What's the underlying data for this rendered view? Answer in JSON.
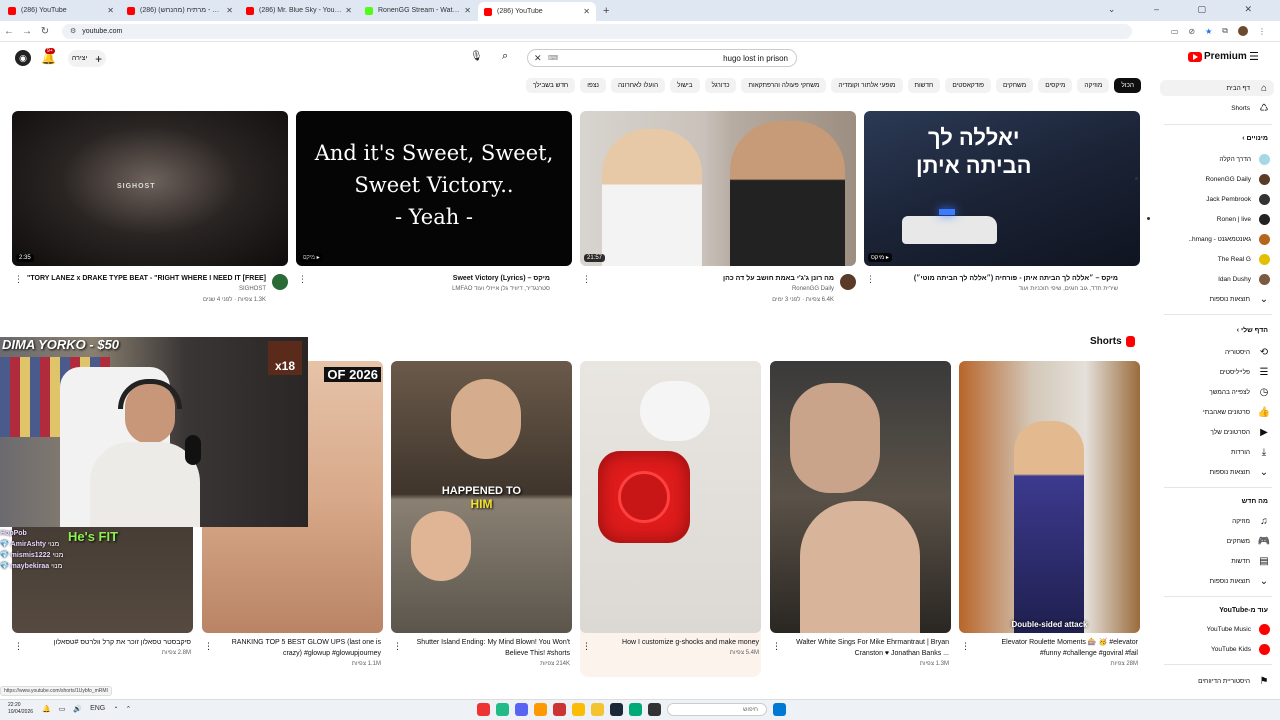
{
  "browser": {
    "tabs": [
      {
        "title": "(286) YouTube",
        "color": "#ff0000"
      },
      {
        "title": "עמוד - מרתיח (מהנחש) (286)",
        "color": "#ff0000"
      },
      {
        "title": "(286) Mr. Blue Sky - YouTube",
        "color": "#ff0000"
      },
      {
        "title": "RonenGG Stream - Watch Live",
        "color": "#53fc18"
      },
      {
        "title": "(286) YouTube",
        "color": "#ff0000"
      }
    ],
    "url": "youtube.com"
  },
  "masthead": {
    "notifications": "9+",
    "create_label": "יצירה",
    "search_value": "hugo lost in prison",
    "logo_label": "Premium"
  },
  "chips": [
    "הכול",
    "מוזיקה",
    "מיקסים",
    "משחקים",
    "פודקאסטים",
    "חדשות",
    "מופעי אלתור וקומדיה",
    "משחקי פעולה והרפתקאות",
    "כדורגל",
    "בישול",
    "הועלו לאחרונה",
    "נצפו",
    "חדש בשבילך"
  ],
  "videos": [
    {
      "title": "מיקס – ״אללה לך הביתה איתן - פורחיה (״אללה לך הביתה מוטי״)",
      "meta1": "שירית חדד, גוב חוגים, שיפי תוכניות ועוד",
      "meta2": "",
      "badge": "מיקס",
      "avatar_color": "#6d7a8a",
      "thumb_text1": "יאללה לך",
      "thumb_text2": "הביתה איתן"
    },
    {
      "title": "מה רונן ג'ג'י באמת חושב על דה כהן",
      "meta1": "RonenGG Daily",
      "meta2": "6.4K צפיות · לפני 3 ימים",
      "badge": "21:57",
      "avatar_color": "#5a3b28"
    },
    {
      "title": "מיקס – Sweet Victory (Lyrics)",
      "meta1": "סטרנגדיר, דיוויד גלן אייזלי ועוד LMFAO",
      "meta2": "",
      "badge": "מיקס",
      "thumb_text1": "And it's Sweet, Sweet,",
      "thumb_text2": "Sweet Victory..",
      "thumb_text3": "- Yeah -"
    },
    {
      "title": "[FREE] TORY LANEZ x DRAKE TYPE BEAT - \"RIGHT WHERE I NEED IT\"",
      "meta1": "SIGHOST",
      "meta2": "1.3K צפיות · לפני 4 שנים",
      "badge": "2:35",
      "avatar_color": "#2a6a35",
      "thumb_text1": "SIGHOST"
    }
  ],
  "shorts_header": "Shorts",
  "shorts": [
    {
      "title": "Elevator Roulette Moments 🎰 🥳 #elevator #funny #challenge #goviral #fail",
      "views": "28M צפיות",
      "overlay": "Double-sided attack"
    },
    {
      "title": "Walter White Sings For Mike Ehrmantraut | Bryan Cranston ♥ Jonathan Banks ...",
      "views": "1.3M צפיות"
    },
    {
      "title": "How I customize g-shocks and make money",
      "views": "5.4M צפיות"
    },
    {
      "title": "Shutter Island Ending: My Mind Blown! You Won't Believe This! #shorts",
      "views": "214K צפיות",
      "overlay": "HAPPENED TO",
      "overlay2": "HIM"
    },
    {
      "title": "RANKING TOP 5 BEST GLOW UPS (last one is crazy) #glowup #glowupjourney",
      "views": "1.1M צפיות",
      "overlay": "OF 2026"
    },
    {
      "title": "סיקבסטר טסאלון זוכר את קרל וולרטס #טסאלון",
      "views": "2.8M צפיות"
    }
  ],
  "stream_overlay": {
    "title": "DIMA YORKO - $50",
    "badge": "x18",
    "fit_text": "He's FIT",
    "chat": [
      {
        "user": "HopPob",
        "role": "",
        "text": ""
      },
      {
        "user": "AmirAshty",
        "role": "מנוי",
        "text": ""
      },
      {
        "user": "mismis1222",
        "role": "מנוי",
        "text": ""
      },
      {
        "user": "maybekiraa",
        "role": "מנוי",
        "text": ""
      }
    ]
  },
  "sidebar": {
    "home": "דף הבית",
    "shorts": "Shorts",
    "subs_header": "מינויים",
    "subs": [
      {
        "name": "הדרך הקלה",
        "color": "#a6d7e6"
      },
      {
        "name": "RonenGG Daily",
        "color": "#5a3b28"
      },
      {
        "name": "Jack Pembrook",
        "color": "#333333"
      },
      {
        "name": "Ronen | live",
        "color": "#222222"
      },
      {
        "name": "גאונטמאגנט - hmang..",
        "color": "#b5651d"
      },
      {
        "name": "The Real G",
        "color": "#e3c000"
      },
      {
        "name": "Idan Dushy",
        "color": "#7a5a40"
      }
    ],
    "more": "תוצאות נוספות",
    "you_header": "הדף שלי",
    "you": [
      {
        "label": "היסטוריה",
        "icon": "⟲"
      },
      {
        "label": "פלייליסטים",
        "icon": "☰"
      },
      {
        "label": "לצפייה בהמשך",
        "icon": "◷"
      },
      {
        "label": "סרטונים שאהבתי",
        "icon": "👍"
      },
      {
        "label": "הסרטונים שלך",
        "icon": "▶"
      },
      {
        "label": "הורדות",
        "icon": "⤓"
      },
      {
        "label": "תוצאות נוספות",
        "icon": "⌄"
      }
    ],
    "explore_header": "מה חדש",
    "explore": [
      {
        "label": "מוזיקה",
        "icon": "♫"
      },
      {
        "label": "משחקים",
        "icon": "🎮"
      },
      {
        "label": "חדשות",
        "icon": "▤"
      },
      {
        "label": "תוצאות נוספות",
        "icon": "⌄"
      }
    ],
    "more_from": "עוד מ-YouTube",
    "more_from_items": [
      {
        "label": "YouTube Music",
        "color": "#ff0000"
      },
      {
        "label": "YouTube Kids",
        "color": "#ff0000"
      }
    ],
    "history_settings": "היסטוריית הדיווחים"
  },
  "status_url": "https://www.youtube.com/shorts/1Uybfo_mRMI",
  "taskbar": {
    "time": "22:20",
    "date": "10/04/2026",
    "lang": "ENG",
    "search_placeholder": "חיפוש"
  }
}
